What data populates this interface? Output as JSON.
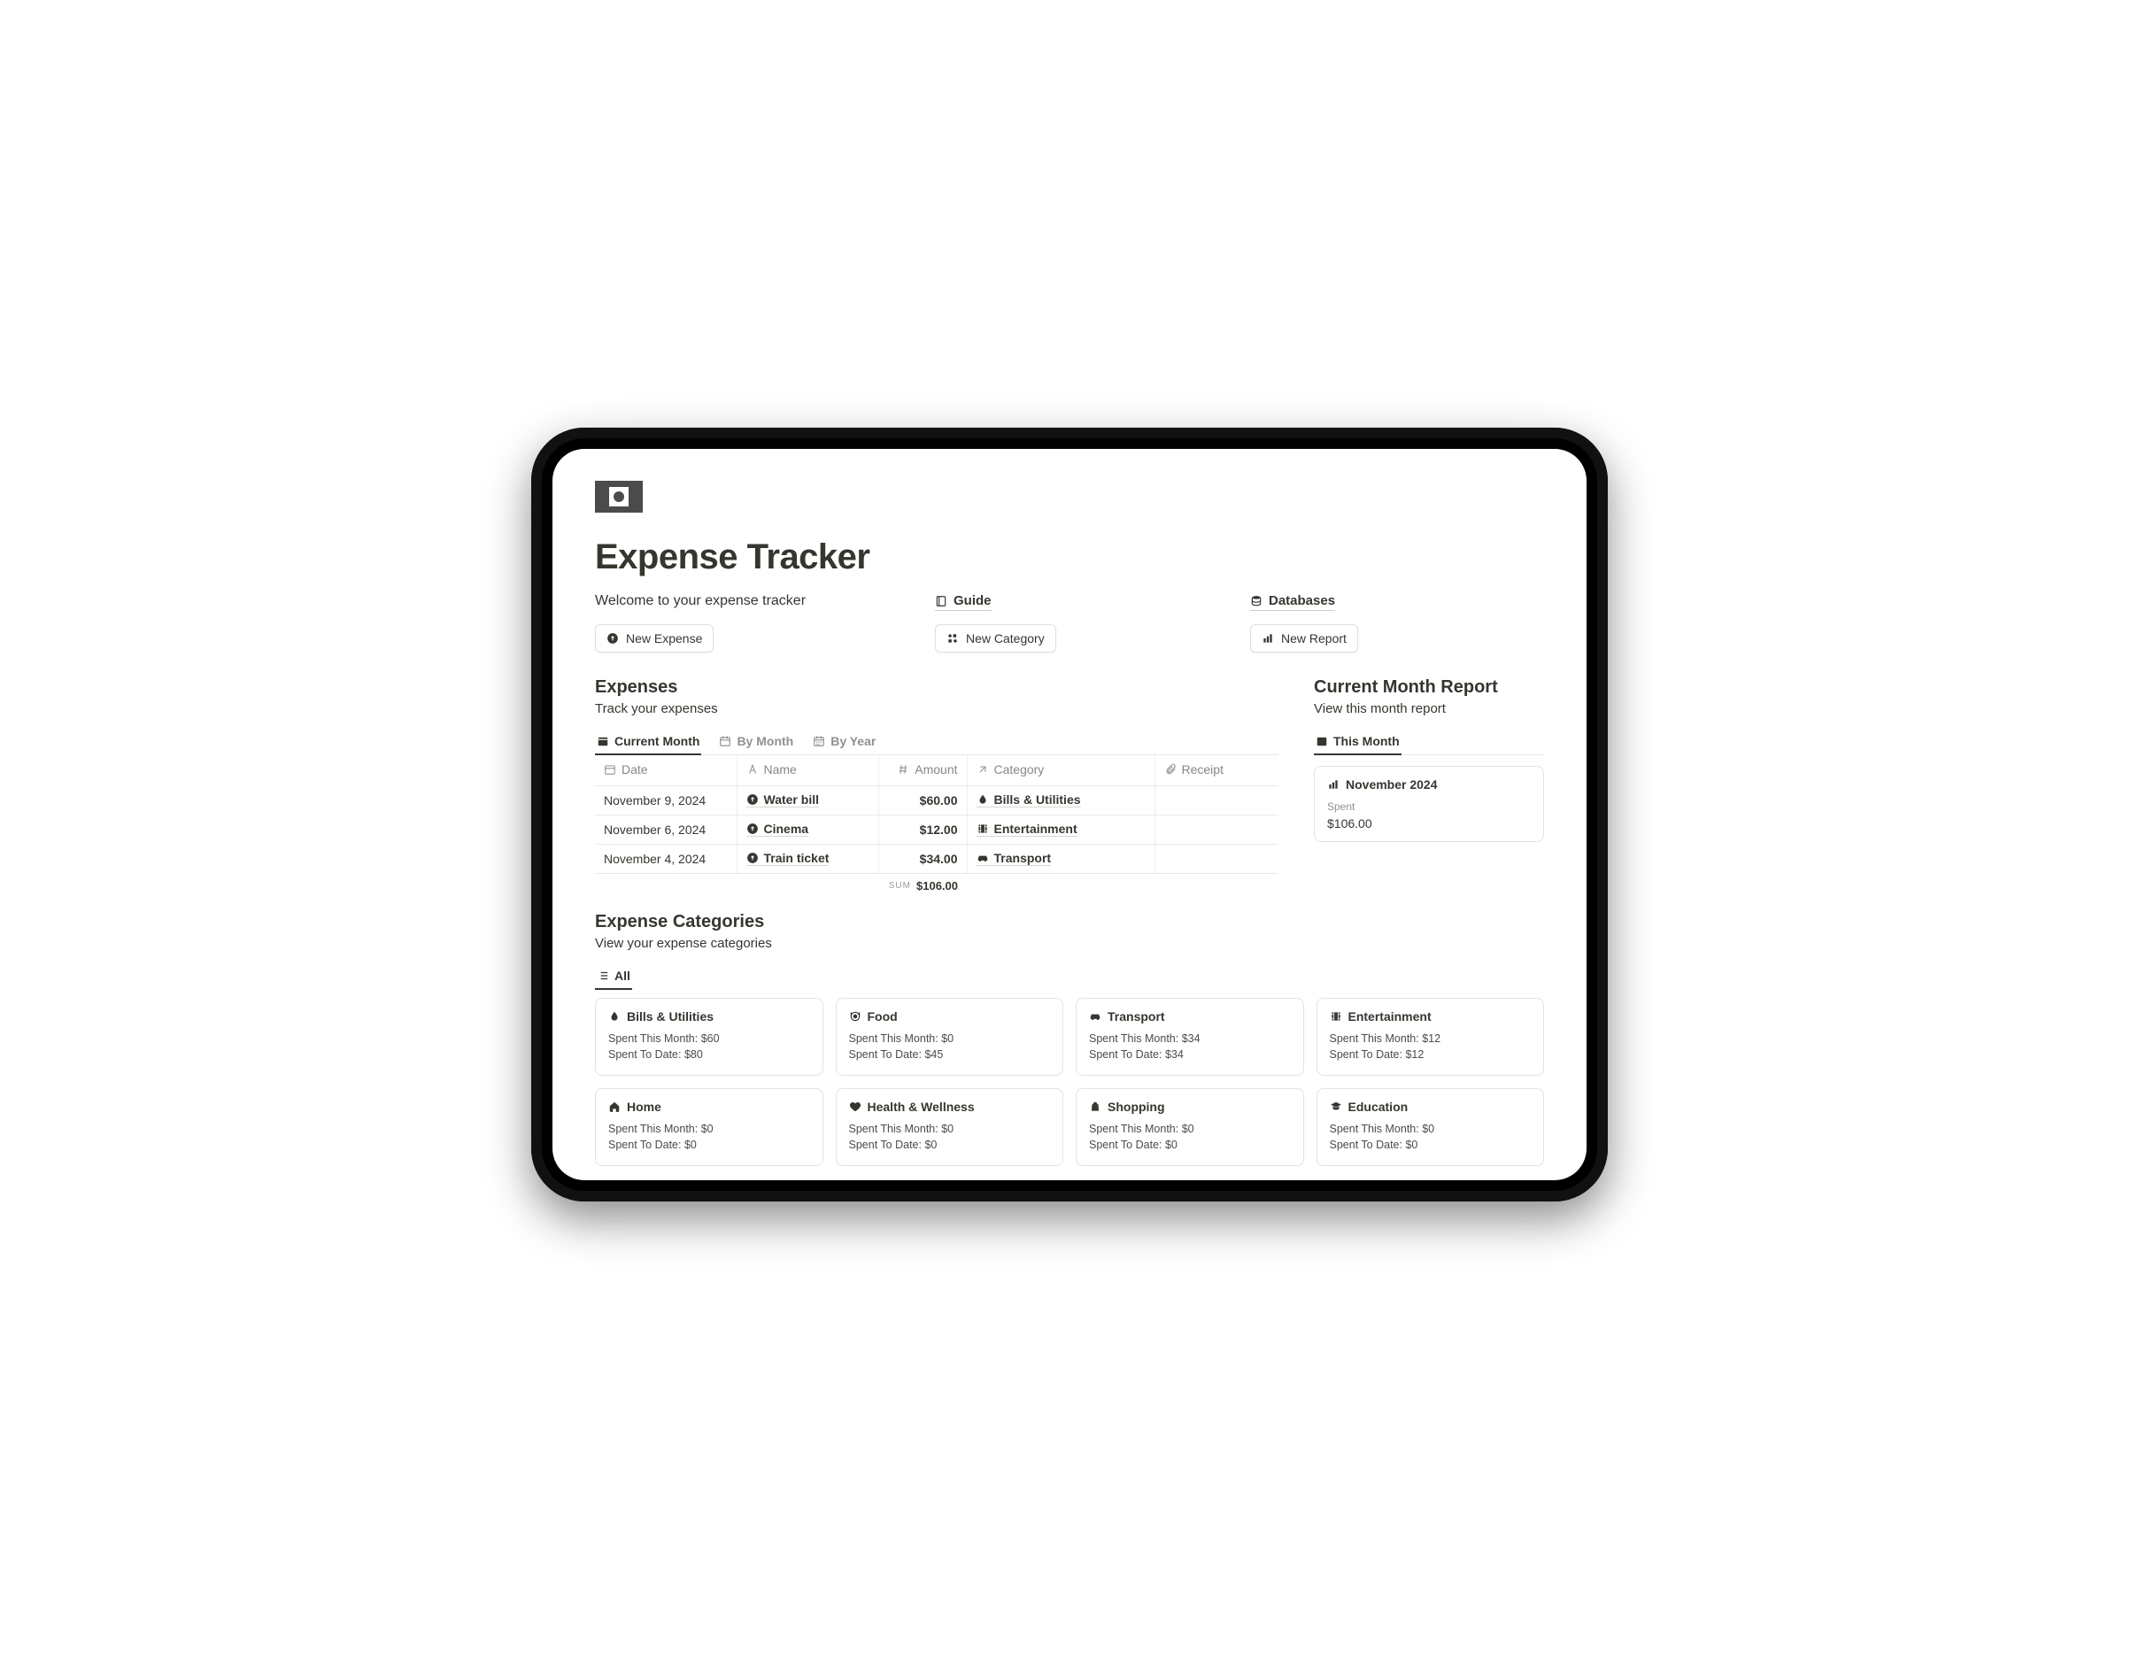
{
  "header": {
    "title": "Expense Tracker",
    "welcome": "Welcome to your expense tracker",
    "guide_link": "Guide",
    "databases_link": "Databases"
  },
  "actions": {
    "new_expense": "New Expense",
    "new_category": "New Category",
    "new_report": "New Report"
  },
  "expenses_section": {
    "heading": "Expenses",
    "sub": "Track your expenses",
    "tabs": {
      "current_month": "Current Month",
      "by_month": "By Month",
      "by_year": "By Year"
    },
    "columns": {
      "date": "Date",
      "name": "Name",
      "amount": "Amount",
      "category": "Category",
      "receipt": "Receipt"
    },
    "rows": [
      {
        "date": "November 9, 2024",
        "name": "Water bill",
        "amount": "$60.00",
        "category": "Bills & Utilities"
      },
      {
        "date": "November 6, 2024",
        "name": "Cinema",
        "amount": "$12.00",
        "category": "Entertainment"
      },
      {
        "date": "November 4, 2024",
        "name": "Train ticket",
        "amount": "$34.00",
        "category": "Transport"
      }
    ],
    "sum_label": "sum",
    "sum_value": "$106.00"
  },
  "report_section": {
    "heading": "Current Month Report",
    "sub": "View this month report",
    "tab": "This Month",
    "card": {
      "name": "November 2024",
      "spent_label": "Spent",
      "spent_value": "$106.00"
    }
  },
  "categories_section": {
    "heading": "Expense Categories",
    "sub": "View your expense categories",
    "tab": "All",
    "stm_prefix": "Spent This Month: ",
    "std_prefix": "Spent To Date: ",
    "cards": [
      {
        "name": "Bills & Utilities",
        "icon": "drop",
        "stm": "$60",
        "std": "$80"
      },
      {
        "name": "Food",
        "icon": "food",
        "stm": "$0",
        "std": "$45"
      },
      {
        "name": "Transport",
        "icon": "car",
        "stm": "$34",
        "std": "$34"
      },
      {
        "name": "Entertainment",
        "icon": "film",
        "stm": "$12",
        "std": "$12"
      },
      {
        "name": "Home",
        "icon": "home",
        "stm": "$0",
        "std": "$0"
      },
      {
        "name": "Health & Wellness",
        "icon": "heart",
        "stm": "$0",
        "std": "$0"
      },
      {
        "name": "Shopping",
        "icon": "bag",
        "stm": "$0",
        "std": "$0"
      },
      {
        "name": "Education",
        "icon": "grad",
        "stm": "$0",
        "std": "$0"
      }
    ]
  }
}
